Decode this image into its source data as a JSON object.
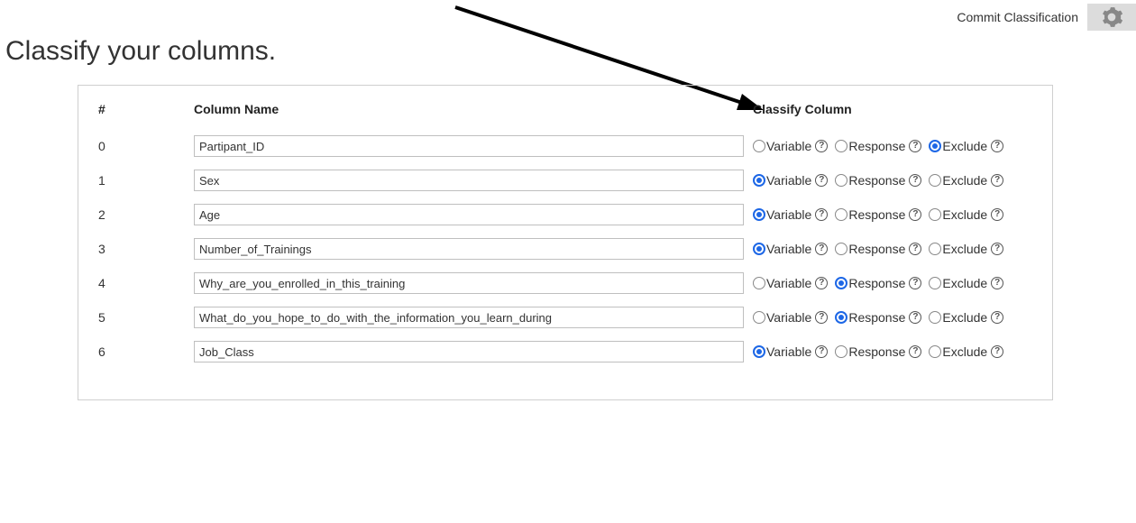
{
  "topbar": {
    "commit_label": "Commit Classification"
  },
  "title": "Classify your columns.",
  "headers": {
    "index": "#",
    "name": "Column Name",
    "classify": "Classify Column"
  },
  "options": {
    "variable": "Variable",
    "response": "Response",
    "exclude": "Exclude"
  },
  "rows": [
    {
      "index": "0",
      "name": "Partipant_ID",
      "selected": "exclude"
    },
    {
      "index": "1",
      "name": "Sex",
      "selected": "variable"
    },
    {
      "index": "2",
      "name": "Age",
      "selected": "variable"
    },
    {
      "index": "3",
      "name": "Number_of_Trainings",
      "selected": "variable"
    },
    {
      "index": "4",
      "name": "Why_are_you_enrolled_in_this_training",
      "selected": "response"
    },
    {
      "index": "5",
      "name": "What_do_you_hope_to_do_with_the_information_you_learn_during",
      "selected": "response"
    },
    {
      "index": "6",
      "name": "Job_Class",
      "selected": "variable"
    }
  ]
}
